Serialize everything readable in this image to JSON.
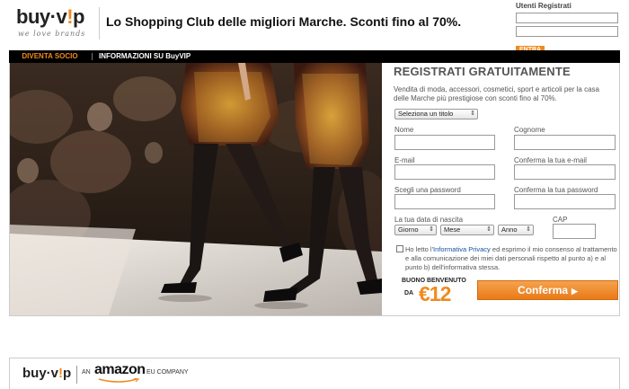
{
  "header": {
    "logo": {
      "word_start": "buy·v",
      "word_exc": "!",
      "word_end": "p",
      "tagline": "we love brands"
    },
    "slogan": "Lo Shopping Club delle migliori Marche. Sconti fino al 70%.",
    "login": {
      "title": "Utenti Registrati",
      "button": "ENTRA"
    }
  },
  "nav": {
    "items": [
      {
        "label": "DIVENTA SOCIO",
        "active": true
      },
      {
        "label": "INFORMAZIONI SU BuyVIP",
        "active": false
      }
    ]
  },
  "form": {
    "title": "REGISTRATI GRATUITAMENTE",
    "description": "Vendita di moda, accessori, cosmetici, sport e articoli per la casa delle Marche più prestigiose con sconti fino al 70%.",
    "title_select": "Seleziona un titolo",
    "fields": {
      "nome": "Nome",
      "cognome": "Cognome",
      "email": "E-mail",
      "email_confirm": "Conferma la tua e-mail",
      "password": "Scegli una password",
      "password_confirm": "Conferma la tua password",
      "birthdate": "La tua data di nascita",
      "cap": "CAP"
    },
    "birth_selects": {
      "day": "Giorno",
      "month": "Mese",
      "year": "Anno"
    },
    "consent": {
      "before": "Ho letto l'",
      "link": "Informativa Privacy",
      "after": " ed esprimo il mio consenso al trattamento e alla comunicazione dei miei dati personali rispetto al punto a) e al punto b) dell'informativa stessa."
    },
    "bonus": {
      "line1": "BUONO BENVENUTO",
      "line2": "DA",
      "amount": "€12"
    },
    "confirm_button": "Conferma"
  },
  "footer": {
    "logo_start": "buy·v",
    "logo_exc": "!",
    "logo_end": "p",
    "an": "AN",
    "amazon": "amazon",
    "eu": "EU COMPANY"
  },
  "colors": {
    "accent": "#f08a1e",
    "nav_bg": "#000000",
    "link": "#1a4fa0"
  }
}
